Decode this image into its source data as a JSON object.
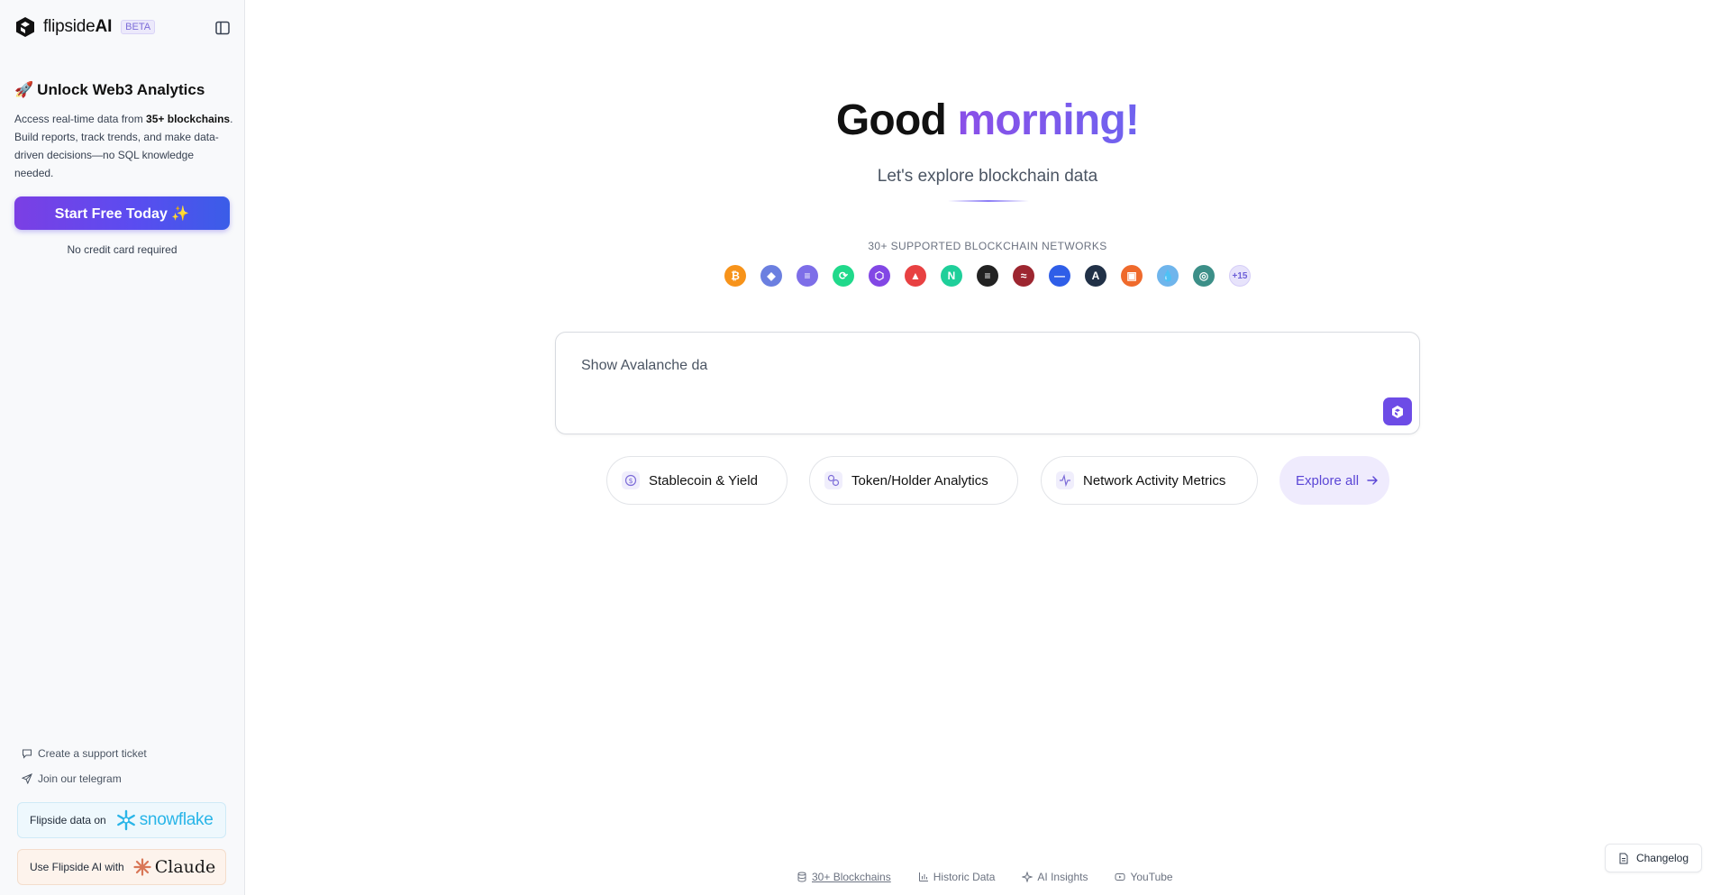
{
  "sidebar": {
    "brand": {
      "name_regular": "flipside",
      "name_bold": "AI",
      "badge": "BETA"
    },
    "promo": {
      "emoji": "🚀",
      "title": "Unlock Web3 Analytics",
      "desc_prefix": "Access real-time data from ",
      "desc_bold": "35+ blockchains",
      "desc_suffix": ". Build reports, track trends, and make data-driven decisions—no SQL knowledge needed."
    },
    "cta_label": "Start Free Today ✨",
    "no_card_text": "No credit card required",
    "links": [
      {
        "label": "Create a support ticket",
        "icon": "message-icon"
      },
      {
        "label": "Join our telegram",
        "icon": "send-icon"
      }
    ],
    "partners": {
      "snowflake": {
        "label": "Flipside data on",
        "logo_text": "snowflake"
      },
      "claude": {
        "label": "Use Flipside AI with",
        "logo_text": "Claude"
      }
    }
  },
  "main": {
    "greeting_prefix": "Good",
    "greeting_accent": "morning!",
    "subtitle": "Let's explore blockchain data",
    "networks_label": "30+ SUPPORTED BLOCKCHAIN NETWORKS",
    "chains": [
      {
        "name": "bitcoin",
        "color": "#f7931a",
        "glyph": "₿"
      },
      {
        "name": "ethereum",
        "color": "#6b7fe0",
        "glyph": "◆"
      },
      {
        "name": "solana",
        "color": "#7d6ee8",
        "glyph": "≡"
      },
      {
        "name": "flow",
        "color": "#20d98b",
        "glyph": "⟳"
      },
      {
        "name": "polygon",
        "color": "#8247e5",
        "glyph": "⬡"
      },
      {
        "name": "avalanche",
        "color": "#e84142",
        "glyph": "▲"
      },
      {
        "name": "near",
        "color": "#1fcf9a",
        "glyph": "N"
      },
      {
        "name": "aptos",
        "color": "#222222",
        "glyph": "≡"
      },
      {
        "name": "sei",
        "color": "#9d2630",
        "glyph": "≈"
      },
      {
        "name": "base",
        "color": "#2f5ee8",
        "glyph": "—"
      },
      {
        "name": "arbitrum",
        "color": "#213147",
        "glyph": "A"
      },
      {
        "name": "blast",
        "color": "#ef6a2c",
        "glyph": "▣"
      },
      {
        "name": "sui",
        "color": "#6fb5ec",
        "glyph": "💧"
      },
      {
        "name": "cosmos",
        "color": "#3c8f88",
        "glyph": "◎"
      }
    ],
    "chains_more": "+15",
    "prompt": {
      "value": "Show Avalanche da",
      "placeholder": ""
    },
    "chips": [
      {
        "label": "Stablecoin & Yield",
        "icon": "dollar-icon"
      },
      {
        "label": "Token/Holder Analytics",
        "icon": "link-icon"
      },
      {
        "label": "Network Activity Metrics",
        "icon": "activity-icon"
      }
    ],
    "explore_label": "Explore all"
  },
  "footer": [
    {
      "label": "30+ Blockchains",
      "icon": "database-icon"
    },
    {
      "label": "Historic Data",
      "icon": "chart-icon"
    },
    {
      "label": "AI Insights",
      "icon": "sparkle-icon"
    },
    {
      "label": "YouTube",
      "icon": "youtube-icon"
    }
  ],
  "changelog_label": "Changelog",
  "colors": {
    "accent": "#6d4ce6",
    "explore_bg": "#efebfd"
  }
}
